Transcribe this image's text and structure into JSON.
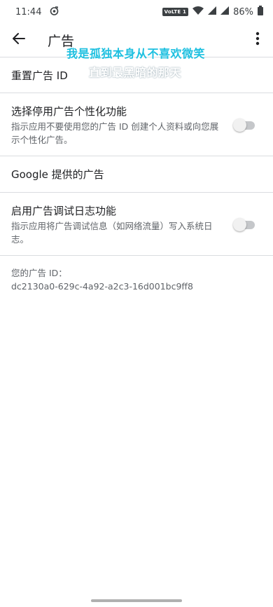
{
  "status_bar": {
    "time": "11:44",
    "volte": "VoLTE 1",
    "battery": "86%"
  },
  "app_bar": {
    "title": "广告",
    "back_icon": "arrow-back-icon",
    "more_icon": "more-vert-icon"
  },
  "overlay": {
    "line1": "我是孤独本身从不喜欢微笑",
    "line2": "直到最黑暗的那天"
  },
  "settings": {
    "reset": {
      "title": "重置广告 ID"
    },
    "opt_out": {
      "title": "选择停用广告个性化功能",
      "subtitle": "指示应用不要使用您的广告 ID 创建个人资料或向您展示个性化广告。",
      "enabled": false
    },
    "google": {
      "title": "Google 提供的广告"
    },
    "debug": {
      "title": "启用广告调试日志功能",
      "subtitle": "指示应用将广告调试信息（如网络流量）写入系统日志。",
      "enabled": false
    }
  },
  "ad_id": {
    "label": "您的广告 ID：",
    "value": "dc2130a0-629c-4a92-a2c3-16d001bc9ff8"
  },
  "colors": {
    "accent_overlay": "#1ec0e0",
    "divider": "#dadce0",
    "toggle_off_track": "#c5c7ca"
  }
}
